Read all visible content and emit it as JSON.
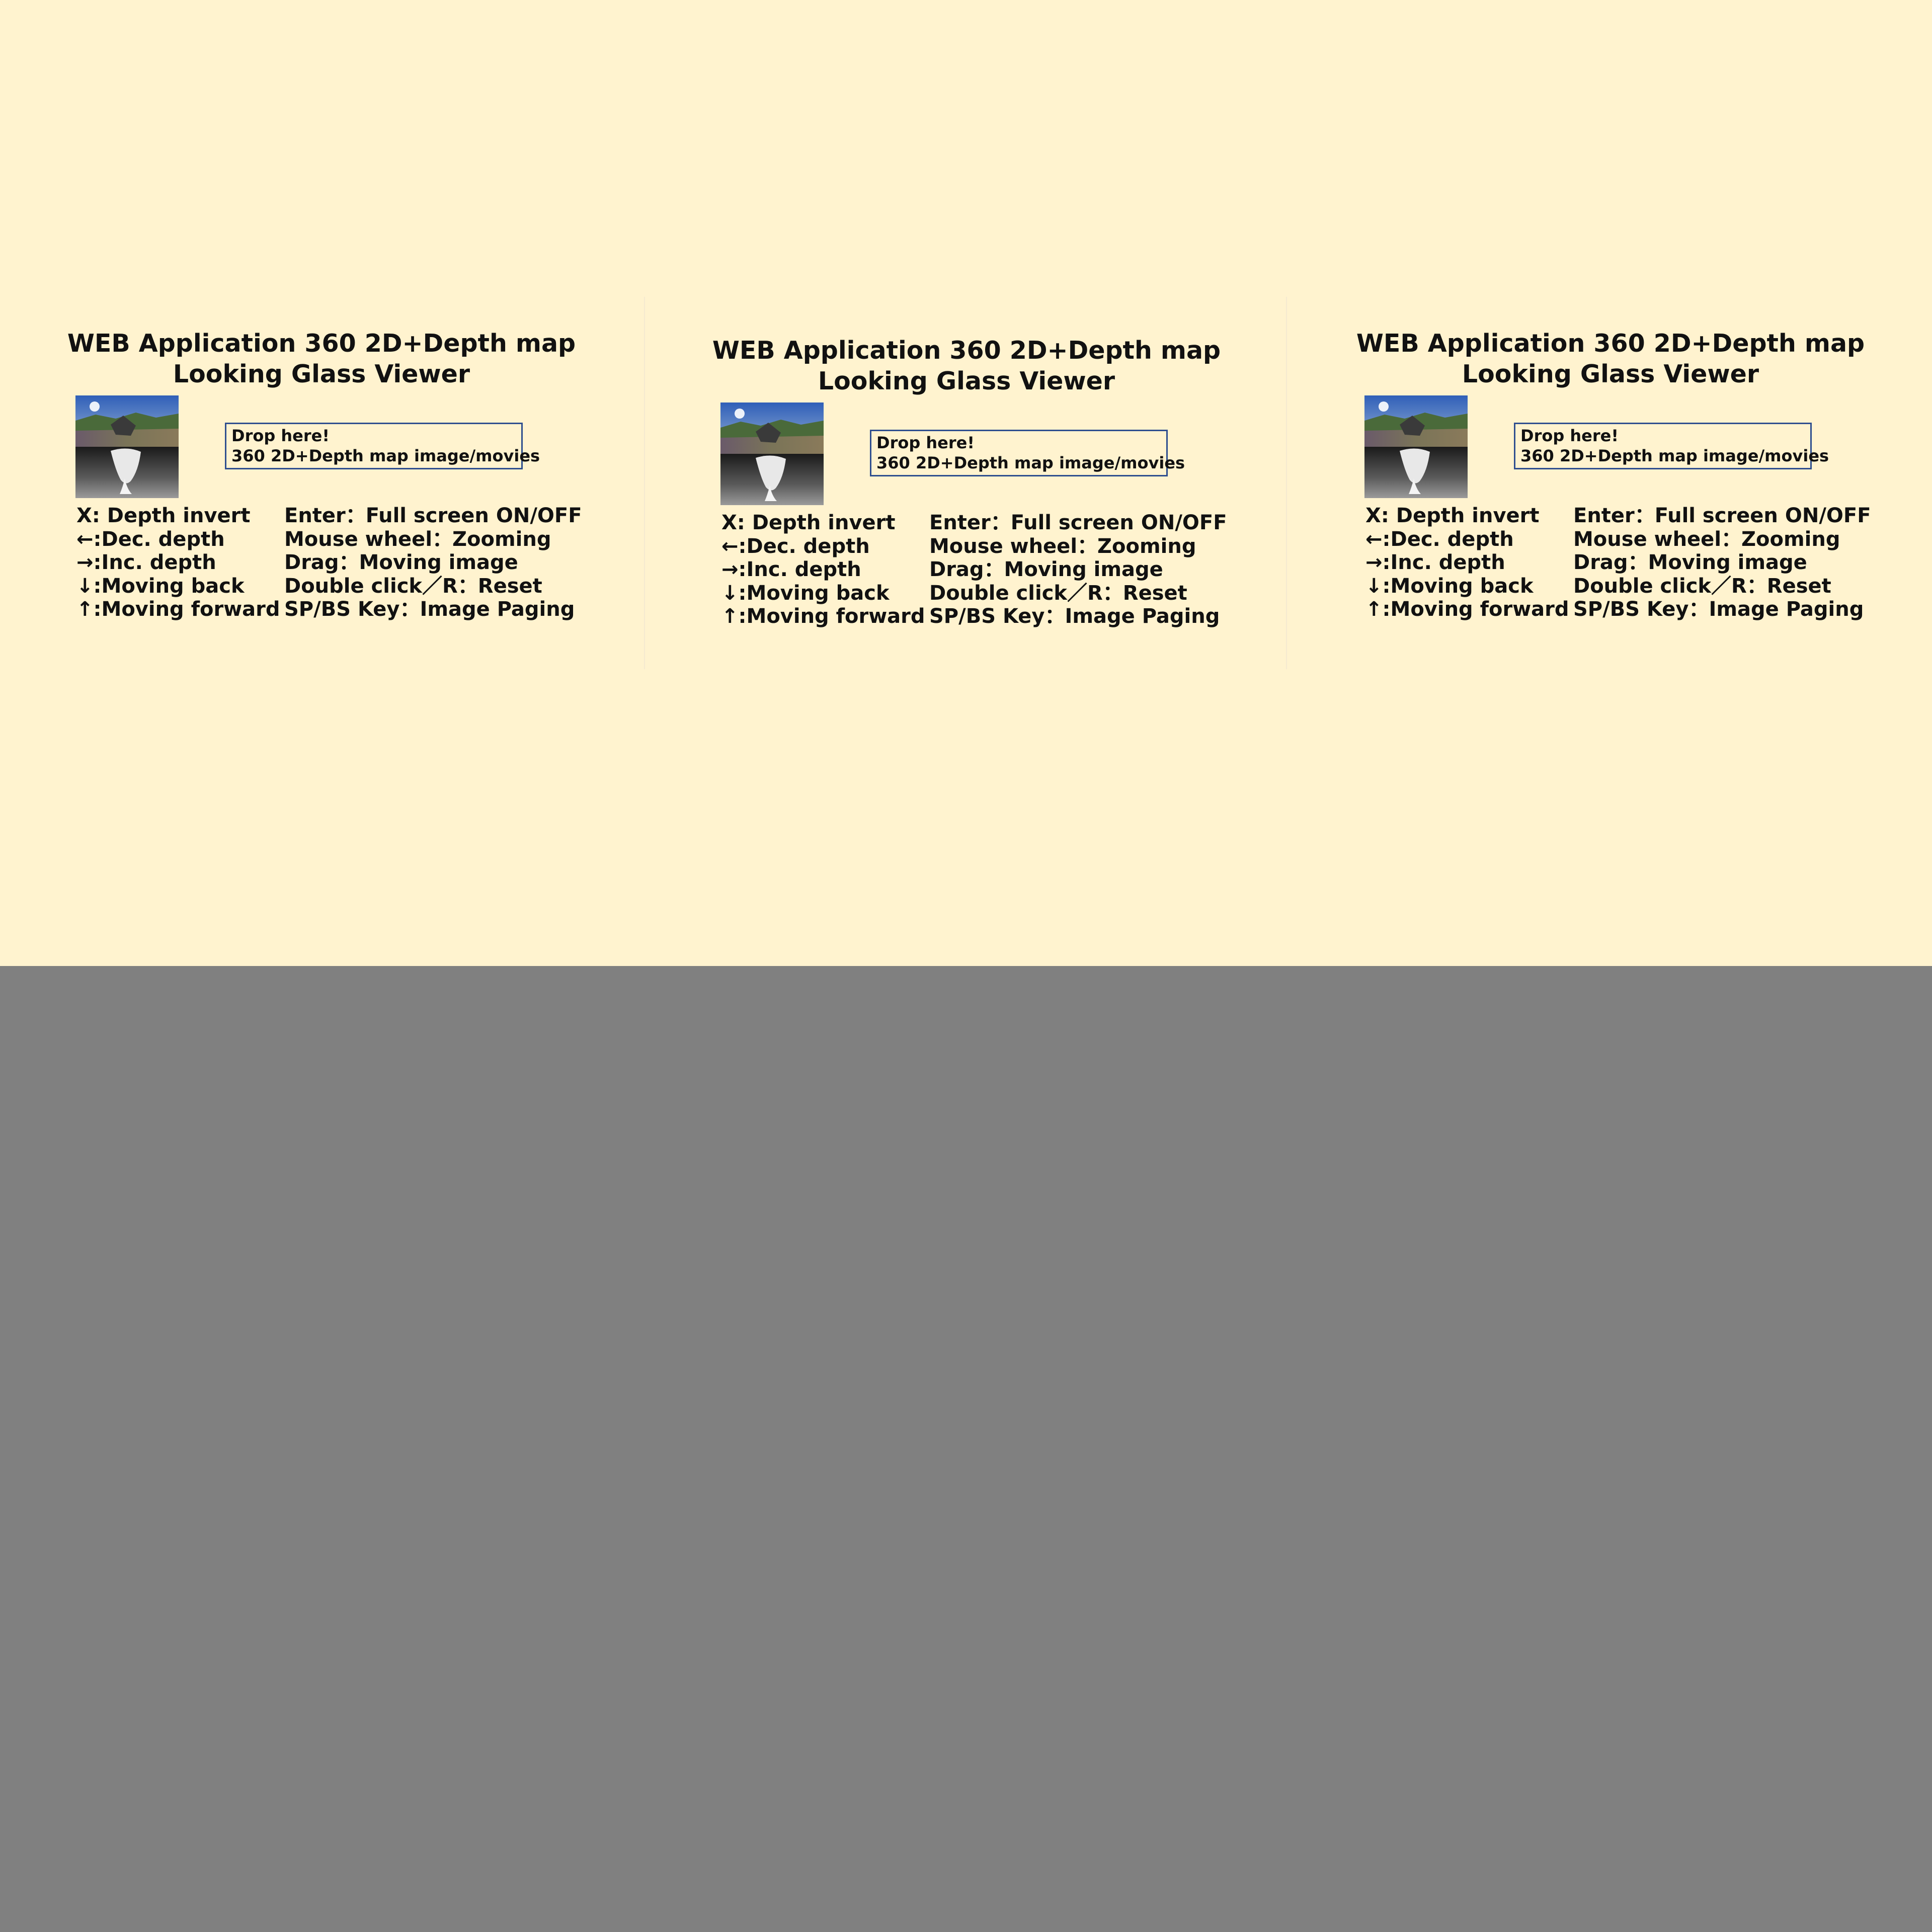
{
  "panels": [
    {
      "title_line1": "WEB Application 360 2D+Depth map",
      "title_line2": "Looking Glass Viewer",
      "drop_line1": "Drop here!",
      "drop_line2": "360 2D+Depth map image/movies",
      "keys_left": [
        "X: Depth invert",
        "←:Dec. depth",
        "→:Inc. depth",
        "↓:Moving back",
        "↑:Moving forward"
      ],
      "keys_right": [
        "Enter：Full screen ON/OFF",
        "Mouse wheel：Zooming",
        "Drag：Moving image",
        "Double click／R：Reset",
        "SP/BS Key：Image Paging"
      ]
    },
    {
      "title_line1": "WEB Application 360 2D+Depth map",
      "title_line2": "Looking Glass Viewer",
      "drop_line1": "Drop here!",
      "drop_line2": "360 2D+Depth map image/movies",
      "keys_left": [
        "X: Depth invert",
        "←:Dec. depth",
        "→:Inc. depth",
        "↓:Moving back",
        "↑:Moving forward"
      ],
      "keys_right": [
        "Enter：Full screen ON/OFF",
        "Mouse wheel：Zooming",
        "Drag：Moving image",
        "Double click／R：Reset",
        "SP/BS Key：Image Paging"
      ]
    },
    {
      "title_line1": "WEB Application 360 2D+Depth map",
      "title_line2": "Looking Glass Viewer",
      "drop_line1": "Drop here!",
      "drop_line2": "360 2D+Depth map image/movies",
      "keys_left": [
        "X: Depth invert",
        "←:Dec. depth",
        "→:Inc. depth",
        "↓:Moving back",
        "↑:Moving forward"
      ],
      "keys_right": [
        "Enter：Full screen ON/OFF",
        "Mouse wheel：Zooming",
        "Drag：Moving image",
        "Double click／R：Reset",
        "SP/BS Key：Image Paging"
      ]
    }
  ],
  "colors": {
    "page_background": "#fff3cf",
    "lower_background": "#808080",
    "dropzone_border": "#2f4f8f",
    "text": "#111111"
  },
  "icons": {
    "preview": "panorama-depth-thumbnail"
  }
}
